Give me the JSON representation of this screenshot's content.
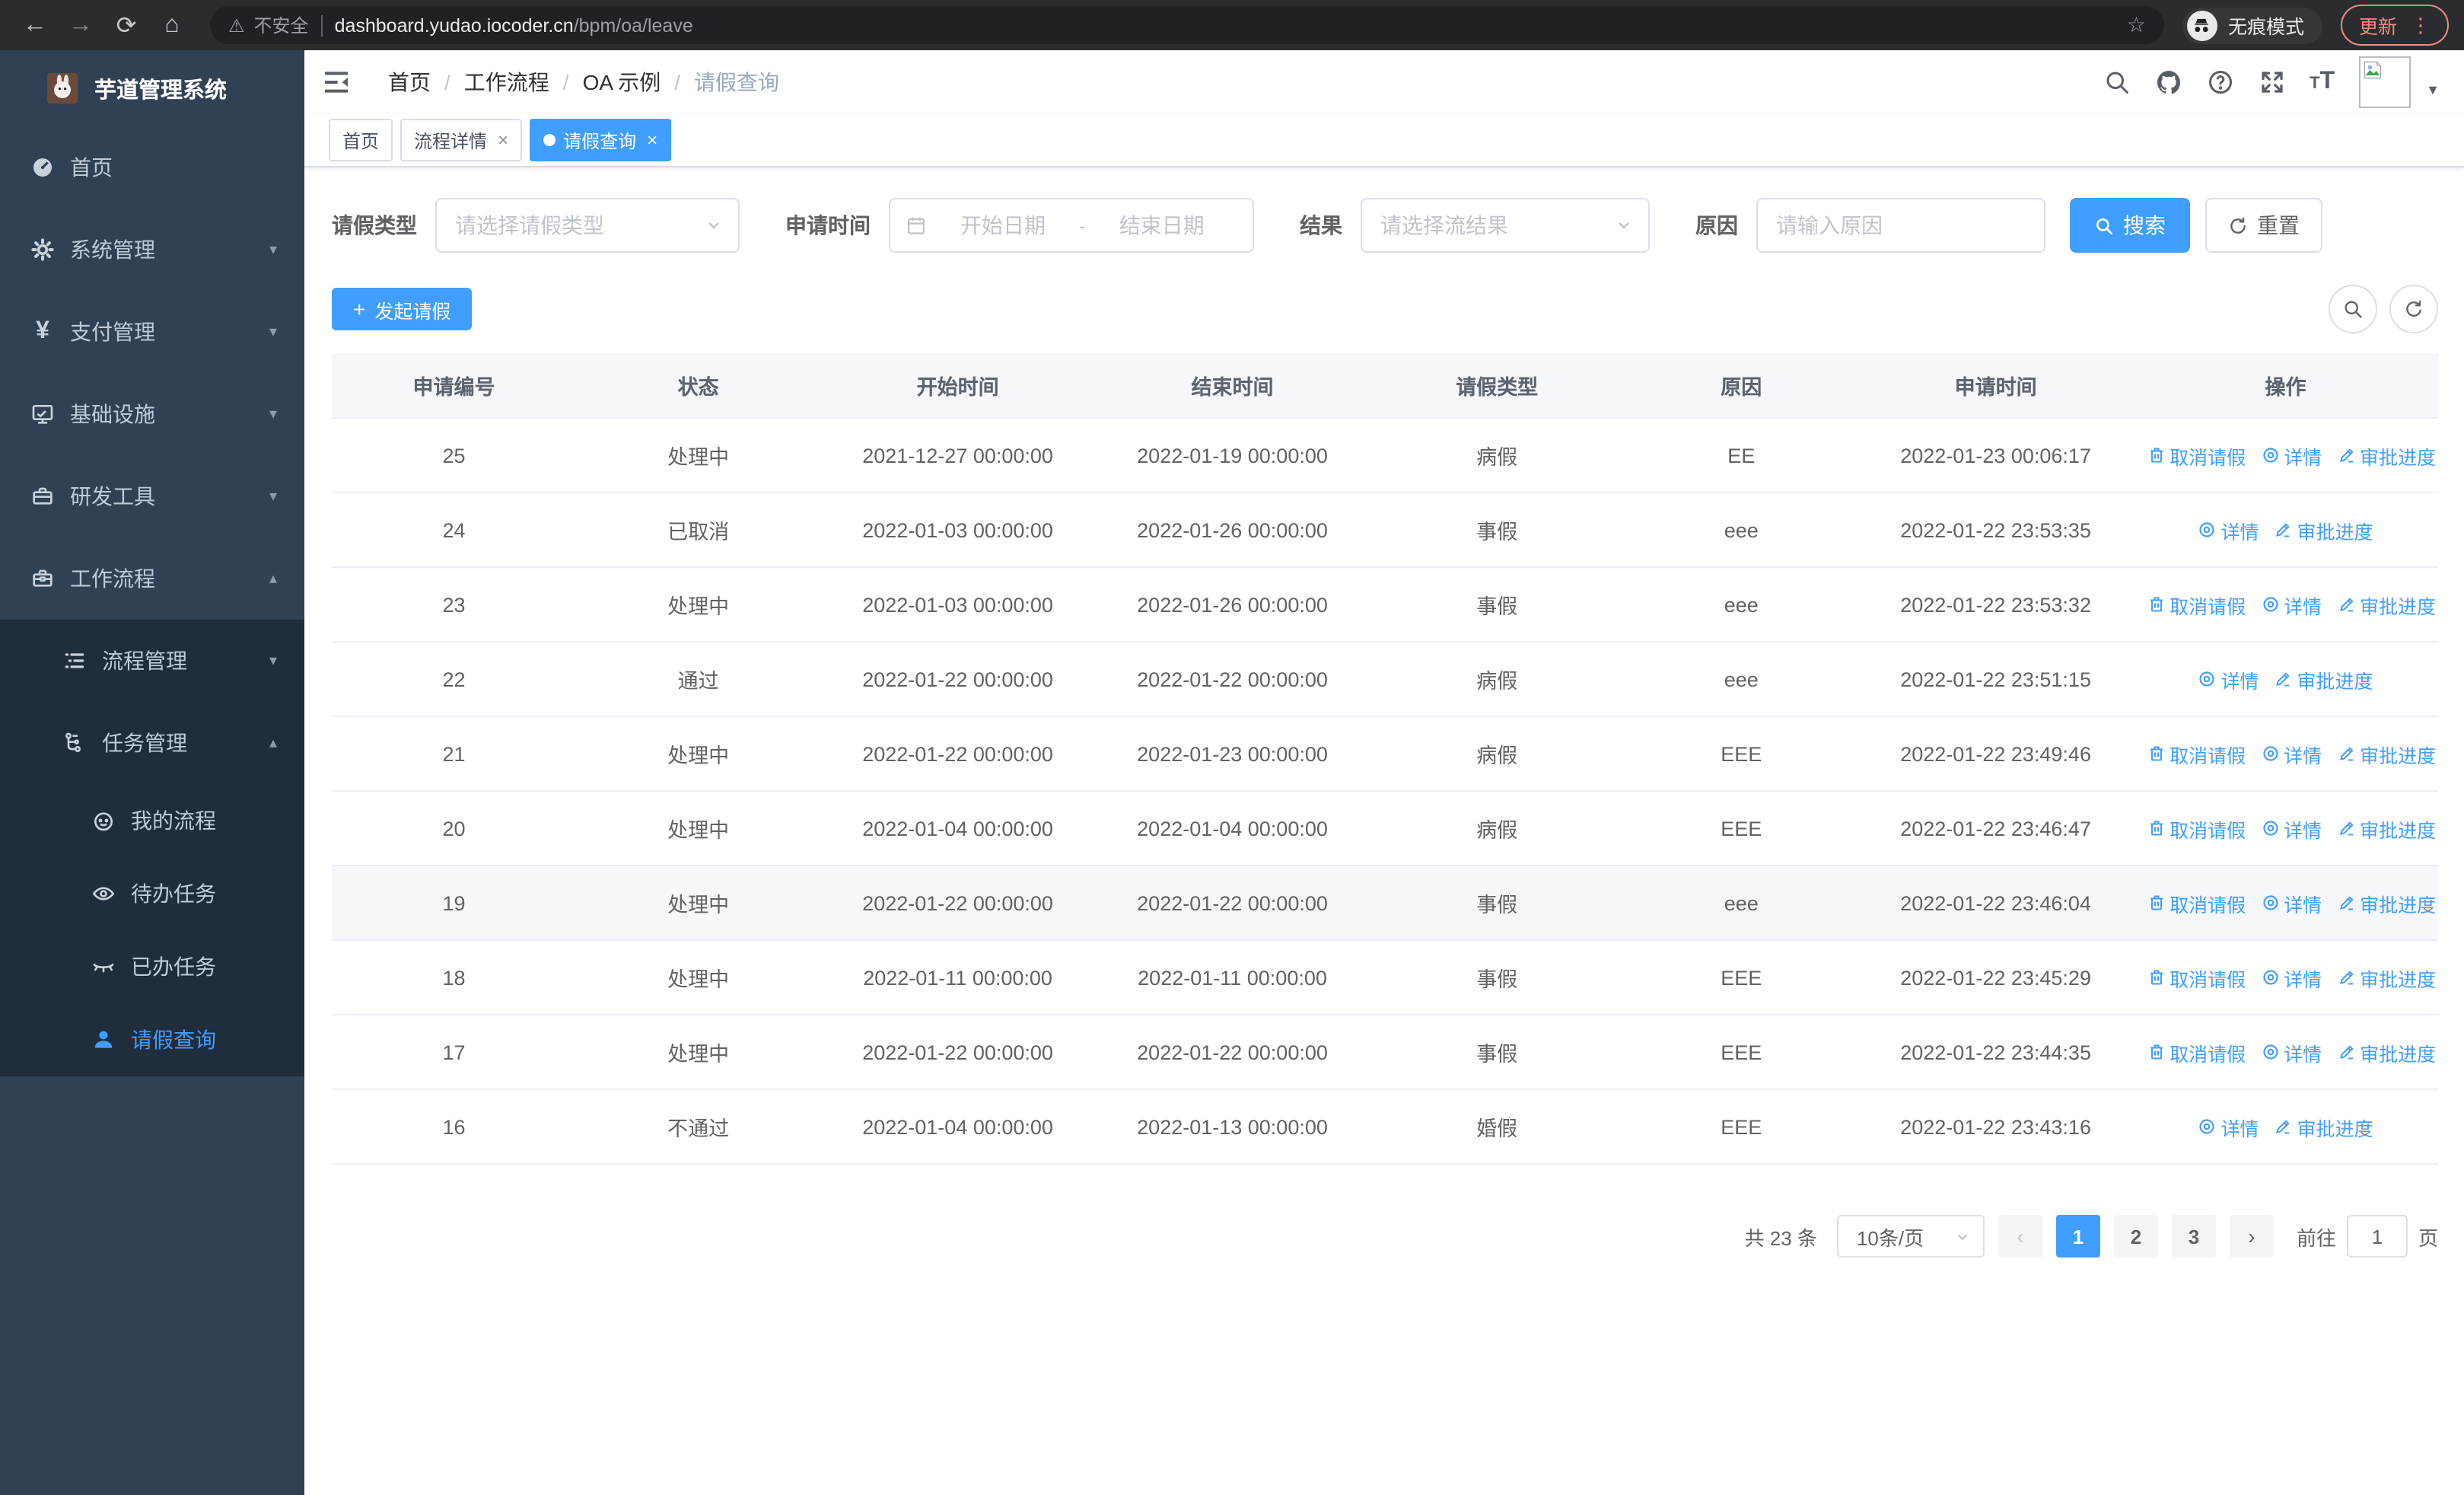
{
  "browser": {
    "security_label": "不安全",
    "url_host": "dashboard.yudao.iocoder.cn",
    "url_path": "/bpm/oa/leave",
    "incognito_label": "无痕模式",
    "update_label": "更新"
  },
  "sidebar": {
    "app_title": "芋道管理系统",
    "items": [
      {
        "label": "首页"
      },
      {
        "label": "系统管理"
      },
      {
        "label": "支付管理"
      },
      {
        "label": "基础设施"
      },
      {
        "label": "研发工具"
      },
      {
        "label": "工作流程"
      },
      {
        "label": "流程管理"
      },
      {
        "label": "任务管理"
      },
      {
        "label": "我的流程"
      },
      {
        "label": "待办任务"
      },
      {
        "label": "已办任务"
      },
      {
        "label": "请假查询"
      }
    ]
  },
  "header": {
    "breadcrumb": [
      "首页",
      "工作流程",
      "OA 示例",
      "请假查询"
    ]
  },
  "tabs": [
    {
      "label": "首页"
    },
    {
      "label": "流程详情"
    },
    {
      "label": "请假查询"
    }
  ],
  "filters": {
    "leave_type_label": "请假类型",
    "leave_type_placeholder": "请选择请假类型",
    "apply_time_label": "申请时间",
    "start_placeholder": "开始日期",
    "range_separator": "-",
    "end_placeholder": "结束日期",
    "result_label": "结果",
    "result_placeholder": "请选择流结果",
    "reason_label": "原因",
    "reason_placeholder": "请输入原因",
    "search_label": "搜索",
    "reset_label": "重置"
  },
  "toolbar": {
    "create_label": "发起请假"
  },
  "table": {
    "columns": [
      "申请编号",
      "状态",
      "开始时间",
      "结束时间",
      "请假类型",
      "原因",
      "申请时间",
      "操作"
    ],
    "action_labels": {
      "cancel": "取消请假",
      "detail": "详情",
      "progress": "审批进度"
    },
    "rows": [
      {
        "id": "25",
        "status": "处理中",
        "start": "2021-12-27 00:00:00",
        "end": "2022-01-19 00:00:00",
        "type": "病假",
        "reason": "EE",
        "apply": "2022-01-23 00:06:17",
        "actions": [
          "cancel",
          "detail",
          "progress"
        ]
      },
      {
        "id": "24",
        "status": "已取消",
        "start": "2022-01-03 00:00:00",
        "end": "2022-01-26 00:00:00",
        "type": "事假",
        "reason": "eee",
        "apply": "2022-01-22 23:53:35",
        "actions": [
          "detail",
          "progress"
        ]
      },
      {
        "id": "23",
        "status": "处理中",
        "start": "2022-01-03 00:00:00",
        "end": "2022-01-26 00:00:00",
        "type": "事假",
        "reason": "eee",
        "apply": "2022-01-22 23:53:32",
        "actions": [
          "cancel",
          "detail",
          "progress"
        ]
      },
      {
        "id": "22",
        "status": "通过",
        "start": "2022-01-22 00:00:00",
        "end": "2022-01-22 00:00:00",
        "type": "病假",
        "reason": "eee",
        "apply": "2022-01-22 23:51:15",
        "actions": [
          "detail",
          "progress"
        ]
      },
      {
        "id": "21",
        "status": "处理中",
        "start": "2022-01-22 00:00:00",
        "end": "2022-01-23 00:00:00",
        "type": "病假",
        "reason": "EEE",
        "apply": "2022-01-22 23:49:46",
        "actions": [
          "cancel",
          "detail",
          "progress"
        ]
      },
      {
        "id": "20",
        "status": "处理中",
        "start": "2022-01-04 00:00:00",
        "end": "2022-01-04 00:00:00",
        "type": "病假",
        "reason": "EEE",
        "apply": "2022-01-22 23:46:47",
        "actions": [
          "cancel",
          "detail",
          "progress"
        ]
      },
      {
        "id": "19",
        "status": "处理中",
        "start": "2022-01-22 00:00:00",
        "end": "2022-01-22 00:00:00",
        "type": "事假",
        "reason": "eee",
        "apply": "2022-01-22 23:46:04",
        "actions": [
          "cancel",
          "detail",
          "progress"
        ],
        "highlighted": true
      },
      {
        "id": "18",
        "status": "处理中",
        "start": "2022-01-11 00:00:00",
        "end": "2022-01-11 00:00:00",
        "type": "事假",
        "reason": "EEE",
        "apply": "2022-01-22 23:45:29",
        "actions": [
          "cancel",
          "detail",
          "progress"
        ]
      },
      {
        "id": "17",
        "status": "处理中",
        "start": "2022-01-22 00:00:00",
        "end": "2022-01-22 00:00:00",
        "type": "事假",
        "reason": "EEE",
        "apply": "2022-01-22 23:44:35",
        "actions": [
          "cancel",
          "detail",
          "progress"
        ]
      },
      {
        "id": "16",
        "status": "不通过",
        "start": "2022-01-04 00:00:00",
        "end": "2022-01-13 00:00:00",
        "type": "婚假",
        "reason": "EEE",
        "apply": "2022-01-22 23:43:16",
        "actions": [
          "detail",
          "progress"
        ]
      }
    ]
  },
  "pagination": {
    "total_text": "共 23 条",
    "page_size_label": "10条/页",
    "pages": [
      "1",
      "2",
      "3"
    ],
    "active_page": "1",
    "goto_label": "前往",
    "goto_value": "1",
    "goto_unit": "页"
  },
  "colors": {
    "accent": "#409eff",
    "sidebar_bg": "#304156",
    "submenu_bg": "#1f2d3d",
    "chrome_bg": "#2b2c2f",
    "update_accent": "#f28b82"
  }
}
